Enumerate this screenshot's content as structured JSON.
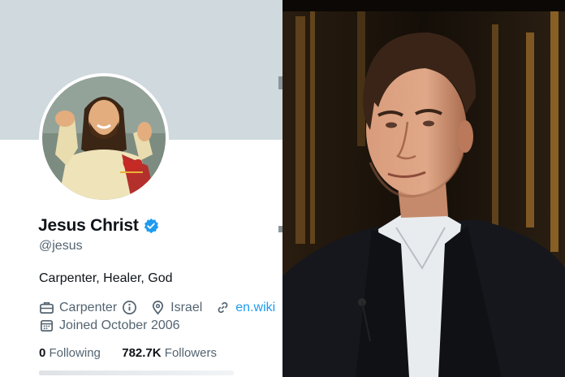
{
  "profile": {
    "name": "Jesus Christ",
    "handle": "@jesus",
    "bio": "Carpenter, Healer, God",
    "occupation": "Carpenter",
    "location": "Israel",
    "link": "en.wiki",
    "joined": "Joined October 2006",
    "following_count": "0",
    "following_label": "Following",
    "followers_count": "782.7K",
    "followers_label": "Followers"
  },
  "icons": {
    "verified": "verified-badge-icon",
    "occupation": "briefcase-icon",
    "info": "info-icon",
    "location": "location-pin-icon",
    "link": "link-icon",
    "joined": "calendar-icon"
  },
  "colors": {
    "banner": "#cfd9de",
    "accent": "#1d9bf0",
    "text_primary": "#0f1419",
    "text_secondary": "#536471"
  }
}
